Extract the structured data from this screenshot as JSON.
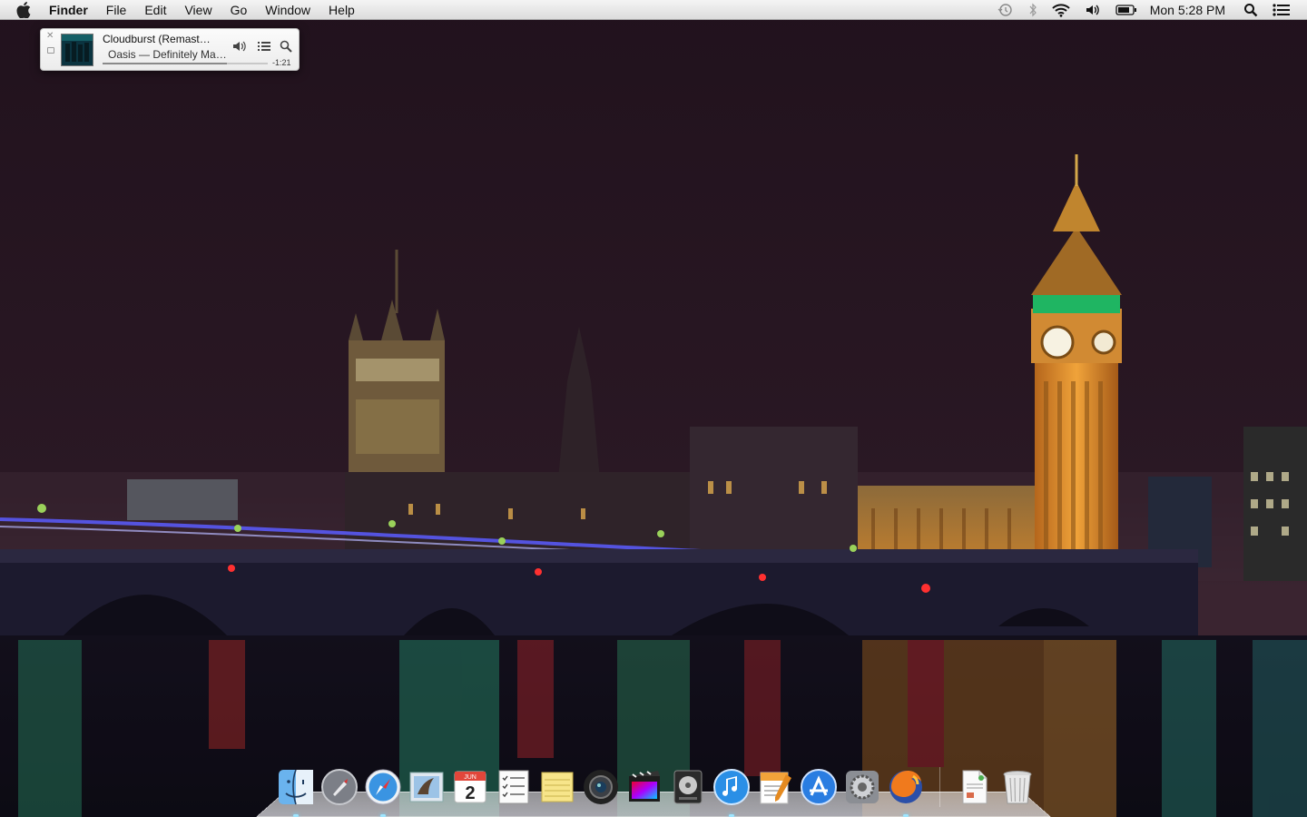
{
  "menubar": {
    "apple_icon": "apple-icon",
    "app_name": "Finder",
    "items": [
      "File",
      "Edit",
      "View",
      "Go",
      "Window",
      "Help"
    ],
    "clock": "Mon 5:28 PM",
    "status_icons": [
      "time-machine-icon",
      "bluetooth-icon",
      "wifi-icon",
      "volume-icon",
      "battery-icon",
      "spotlight-icon",
      "notification-center-icon"
    ]
  },
  "mini_player": {
    "title": "Cloudburst (Remast…",
    "subtitle": "Oasis — Definitely Ma…",
    "time_remaining": "-1:21",
    "progress": 0.75
  },
  "dock": {
    "apps": [
      "finder",
      "launchpad",
      "safari",
      "mail",
      "calendar",
      "reminders",
      "notes",
      "photo-booth",
      "final-cut-pro",
      "logic-pro",
      "itunes",
      "pages",
      "app-store",
      "system-preferences",
      "firefox"
    ],
    "calendar_day": "2",
    "calendar_month": "JUN",
    "extras": [
      "document",
      "trash"
    ]
  },
  "colors": {
    "sky": "#24141f",
    "water_accent": "#2c8f6a",
    "tower_gold": "#d98a2a",
    "dock_dot": "#9fe6ff"
  }
}
